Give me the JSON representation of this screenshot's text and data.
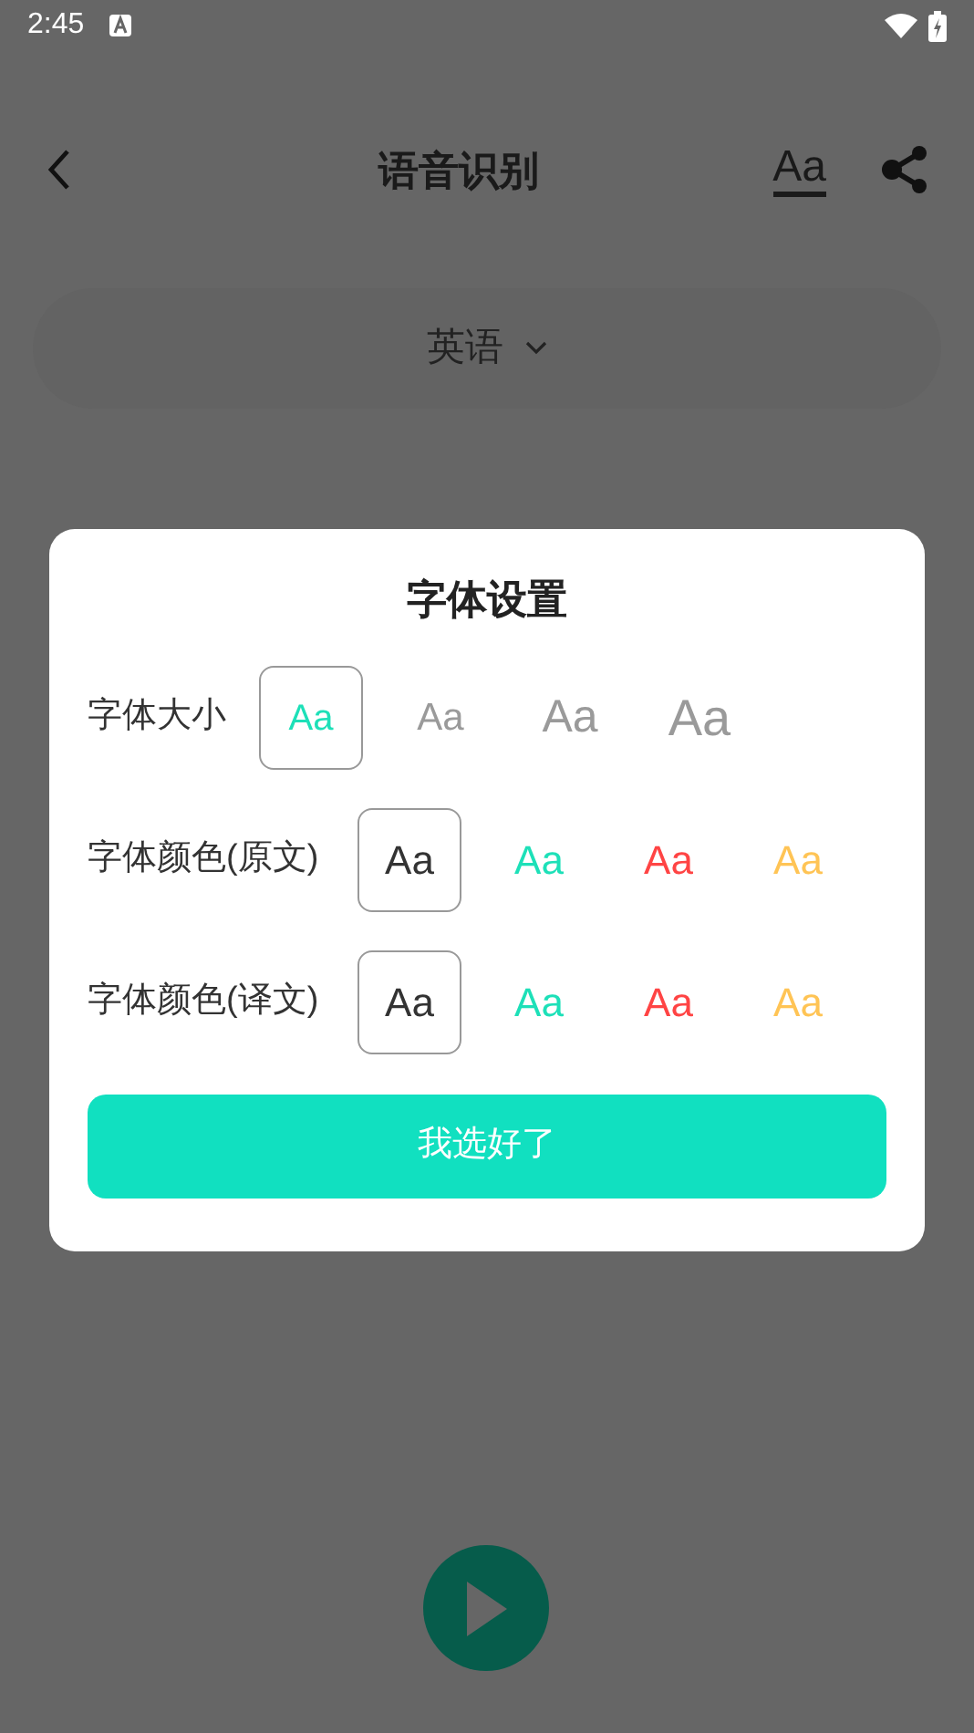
{
  "status_bar": {
    "time": "2:45"
  },
  "header": {
    "title": "语音识别",
    "font_button": "Aa"
  },
  "language_selector": {
    "label": "英语"
  },
  "dialog": {
    "title": "字体设置",
    "rows": [
      {
        "kind": "size",
        "label": "字体大小",
        "options": [
          {
            "text": "Aa",
            "selected": true
          },
          {
            "text": "Aa",
            "selected": false
          },
          {
            "text": "Aa",
            "selected": false
          },
          {
            "text": "Aa",
            "selected": false
          }
        ]
      },
      {
        "kind": "color",
        "label": "字体颜色(原文)",
        "options": [
          {
            "text": "Aa",
            "selected": true,
            "color": "#333333"
          },
          {
            "text": "Aa",
            "selected": false,
            "color": "#1de0b8"
          },
          {
            "text": "Aa",
            "selected": false,
            "color": "#ff4444"
          },
          {
            "text": "Aa",
            "selected": false,
            "color": "#ffc455"
          }
        ]
      },
      {
        "kind": "color",
        "label": "字体颜色(译文)",
        "options": [
          {
            "text": "Aa",
            "selected": true,
            "color": "#333333"
          },
          {
            "text": "Aa",
            "selected": false,
            "color": "#1de0b8"
          },
          {
            "text": "Aa",
            "selected": false,
            "color": "#ff4444"
          },
          {
            "text": "Aa",
            "selected": false,
            "color": "#ffc455"
          }
        ]
      }
    ],
    "confirm_button": "我选好了"
  }
}
